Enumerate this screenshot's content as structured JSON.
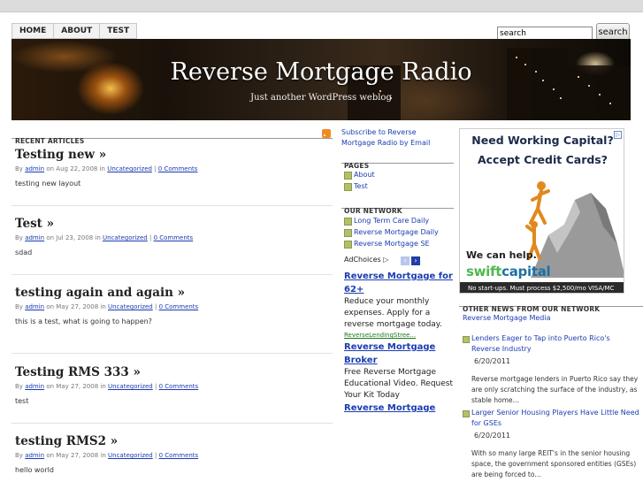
{
  "nav": {
    "items": [
      "HOME",
      "ABOUT",
      "TEST"
    ]
  },
  "search": {
    "value": "search",
    "button": "search"
  },
  "header": {
    "title": "Reverse Mortgage Radio",
    "tagline": "Just another WordPress weblog"
  },
  "recent": {
    "heading": "RECENT ARTICLES",
    "posts": [
      {
        "title": "Testing new »",
        "by": "By",
        "author": "admin",
        "on": "on Aug 22, 2008 in",
        "category": "Uncategorized",
        "sep": "|",
        "comments": "0 Comments",
        "body": "testing new layout"
      },
      {
        "title": "Test »",
        "by": "By",
        "author": "admin",
        "on": "on Jul 23, 2008 in",
        "category": "Uncategorized",
        "sep": "|",
        "comments": "0 Comments",
        "body": "sdad"
      },
      {
        "title": "testing again and again »",
        "by": "By",
        "author": "admin",
        "on": "on May 27, 2008 in",
        "category": "Uncategorized",
        "sep": "|",
        "comments": "0 Comments",
        "body": "this is a test, what is going to happen?"
      },
      {
        "title": "Testing RMS 333 »",
        "by": "By",
        "author": "admin",
        "on": "on May 27, 2008 in",
        "category": "Uncategorized",
        "sep": "|",
        "comments": "0 Comments",
        "body": "test"
      },
      {
        "title": "testing RMS2 »",
        "by": "By",
        "author": "admin",
        "on": "on May 27, 2008 in",
        "category": "Uncategorized",
        "sep": "|",
        "comments": "0 Comments",
        "body": "hello world"
      }
    ]
  },
  "sidebar": {
    "subscribe": "Subscribe to Reverse Mortgage Radio by Email",
    "pages_heading": "PAGES",
    "pages": [
      "About",
      "Test"
    ],
    "network_heading": "OUR NETWORK",
    "network": [
      "Long Term Care Daily",
      "Reverse Mortgage Daily",
      "Reverse Mortgage SE"
    ]
  },
  "ads": {
    "adchoices": "AdChoices",
    "ad1": {
      "title": "Reverse Mortgage for 62+",
      "text": "Reduce your monthly expenses. Apply for a reverse mortgage today.",
      "url": "ReverseLendingStree..."
    },
    "ad2": {
      "title": "Reverse Mortgage Broker",
      "text": "Free Reverse Mortgage Educational Video. Request Your Kit Today"
    },
    "ad3": {
      "title": "Reverse Mortgage"
    }
  },
  "banner_ad": {
    "line1": "Need Working Capital?",
    "line2": "Accept Credit Cards?",
    "can_help": "We can help.",
    "brand_a": "swift",
    "brand_b": "capital",
    "foot": "No start-ups. Must process $2,500/mo VISA/MC"
  },
  "other_news": {
    "heading": "OTHER NEWS FROM OUR NETWORK",
    "source": "Reverse Mortgage Media",
    "items": [
      {
        "title": "Lenders Eager to Tap into Puerto Rico's Reverse Industry",
        "date": "6/20/2011",
        "summary": "Reverse mortgage lenders in Puerto Rico say they are only scratching the surface of the industry, as stable home…"
      },
      {
        "title": "Larger Senior Housing Players Have Little Need for GSEs",
        "date": "6/20/2011",
        "summary": "With so many large REIT's in the senior housing space, the government sponsored entities (GSEs) are being forced to…"
      }
    ]
  },
  "colors": {
    "link": "#1a3cb0",
    "bullet": "#b3c06a",
    "rss": "#f08a24"
  }
}
